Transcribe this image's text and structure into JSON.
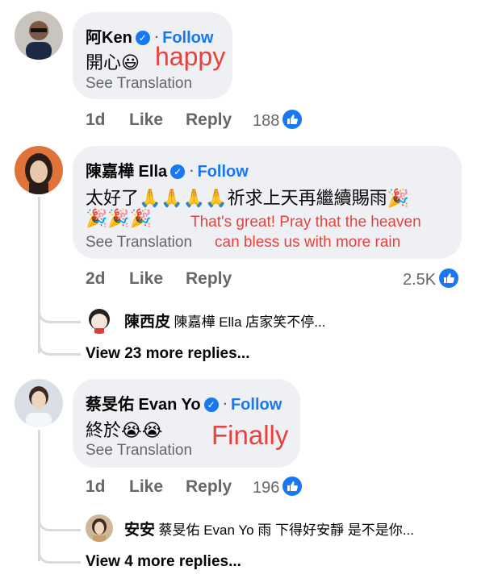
{
  "comments": [
    {
      "author": "阿Ken",
      "follow": "Follow",
      "separator": "·",
      "text": "開心",
      "emoji": "😃",
      "annotation": "happy",
      "see_translation": "See Translation",
      "time": "1d",
      "like": "Like",
      "reply": "Reply",
      "reaction_count": "188"
    },
    {
      "author": "陳嘉樺 Ella",
      "follow": "Follow",
      "separator": "·",
      "text": "太好了",
      "pray": "🙏🙏🙏🙏",
      "text2": "祈求上天再繼續賜雨",
      "party": "🎉",
      "party_row": "🎉🎉🎉",
      "annotation_line1": "That's great! Pray that the heaven",
      "annotation_line2": "can bless us with more rain",
      "see_translation": "See Translation",
      "time": "2d",
      "like": "Like",
      "reply": "Reply",
      "reaction_count": "2.5K",
      "reply_preview": {
        "author": "陳西皮",
        "text": "陳嘉樺 Ella 店家笑不停..."
      },
      "more_replies": "View 23 more replies..."
    },
    {
      "author": "蔡旻佑 Evan Yo",
      "follow": "Follow",
      "separator": "·",
      "text": "終於",
      "emoji": "😭😭",
      "annotation": "Finally",
      "see_translation": "See Translation",
      "time": "1d",
      "like": "Like",
      "reply": "Reply",
      "reaction_count": "196",
      "reply_preview": {
        "author": "安安",
        "text": "蔡旻佑 Evan Yo 雨 下得好安靜 是不是你..."
      },
      "more_replies": "View 4 more replies..."
    }
  ],
  "colors": {
    "accent": "#1877f2",
    "annotation": "#e8423f",
    "bubble": "#eef0f3",
    "muted": "#65676b"
  },
  "icons": [
    "verified-badge-icon",
    "thumbs-up-icon",
    "thread-line"
  ]
}
